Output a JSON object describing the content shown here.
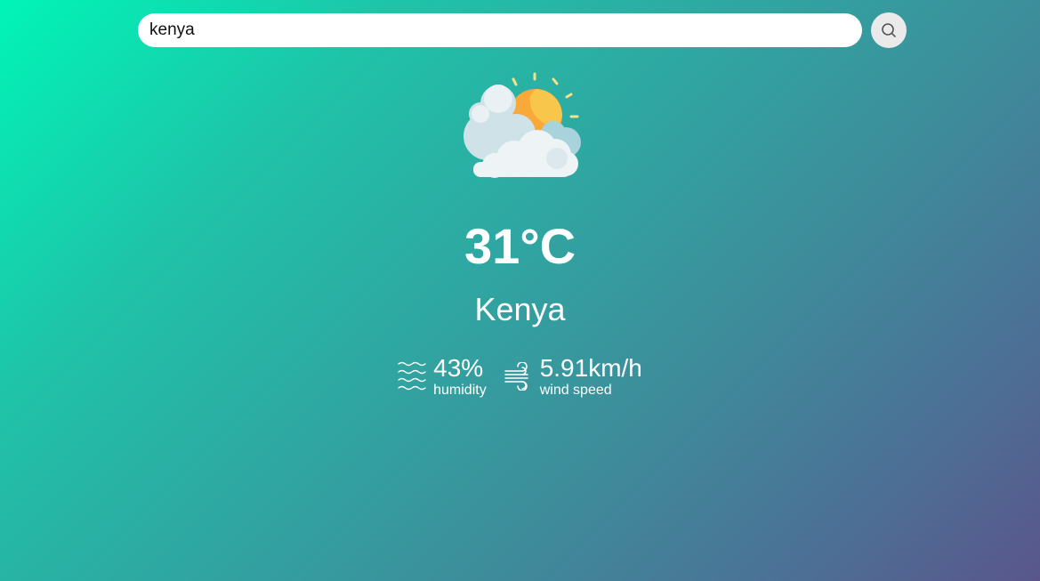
{
  "search": {
    "value": "kenya",
    "icon": "search-icon"
  },
  "weather": {
    "icon": "partly-cloudy-sun-icon",
    "temperature": "31°C",
    "city": "Kenya"
  },
  "details": {
    "humidity": {
      "icon": "humidity-waves-icon",
      "value": "43%",
      "label": "humidity"
    },
    "wind": {
      "icon": "wind-icon",
      "value": "5.91km/h",
      "label": "wind speed"
    }
  },
  "colors": {
    "gradient_start": "#00f5b8",
    "gradient_end": "#5a568c",
    "sun": "#f9b233",
    "cloud": "#eef3f6"
  }
}
